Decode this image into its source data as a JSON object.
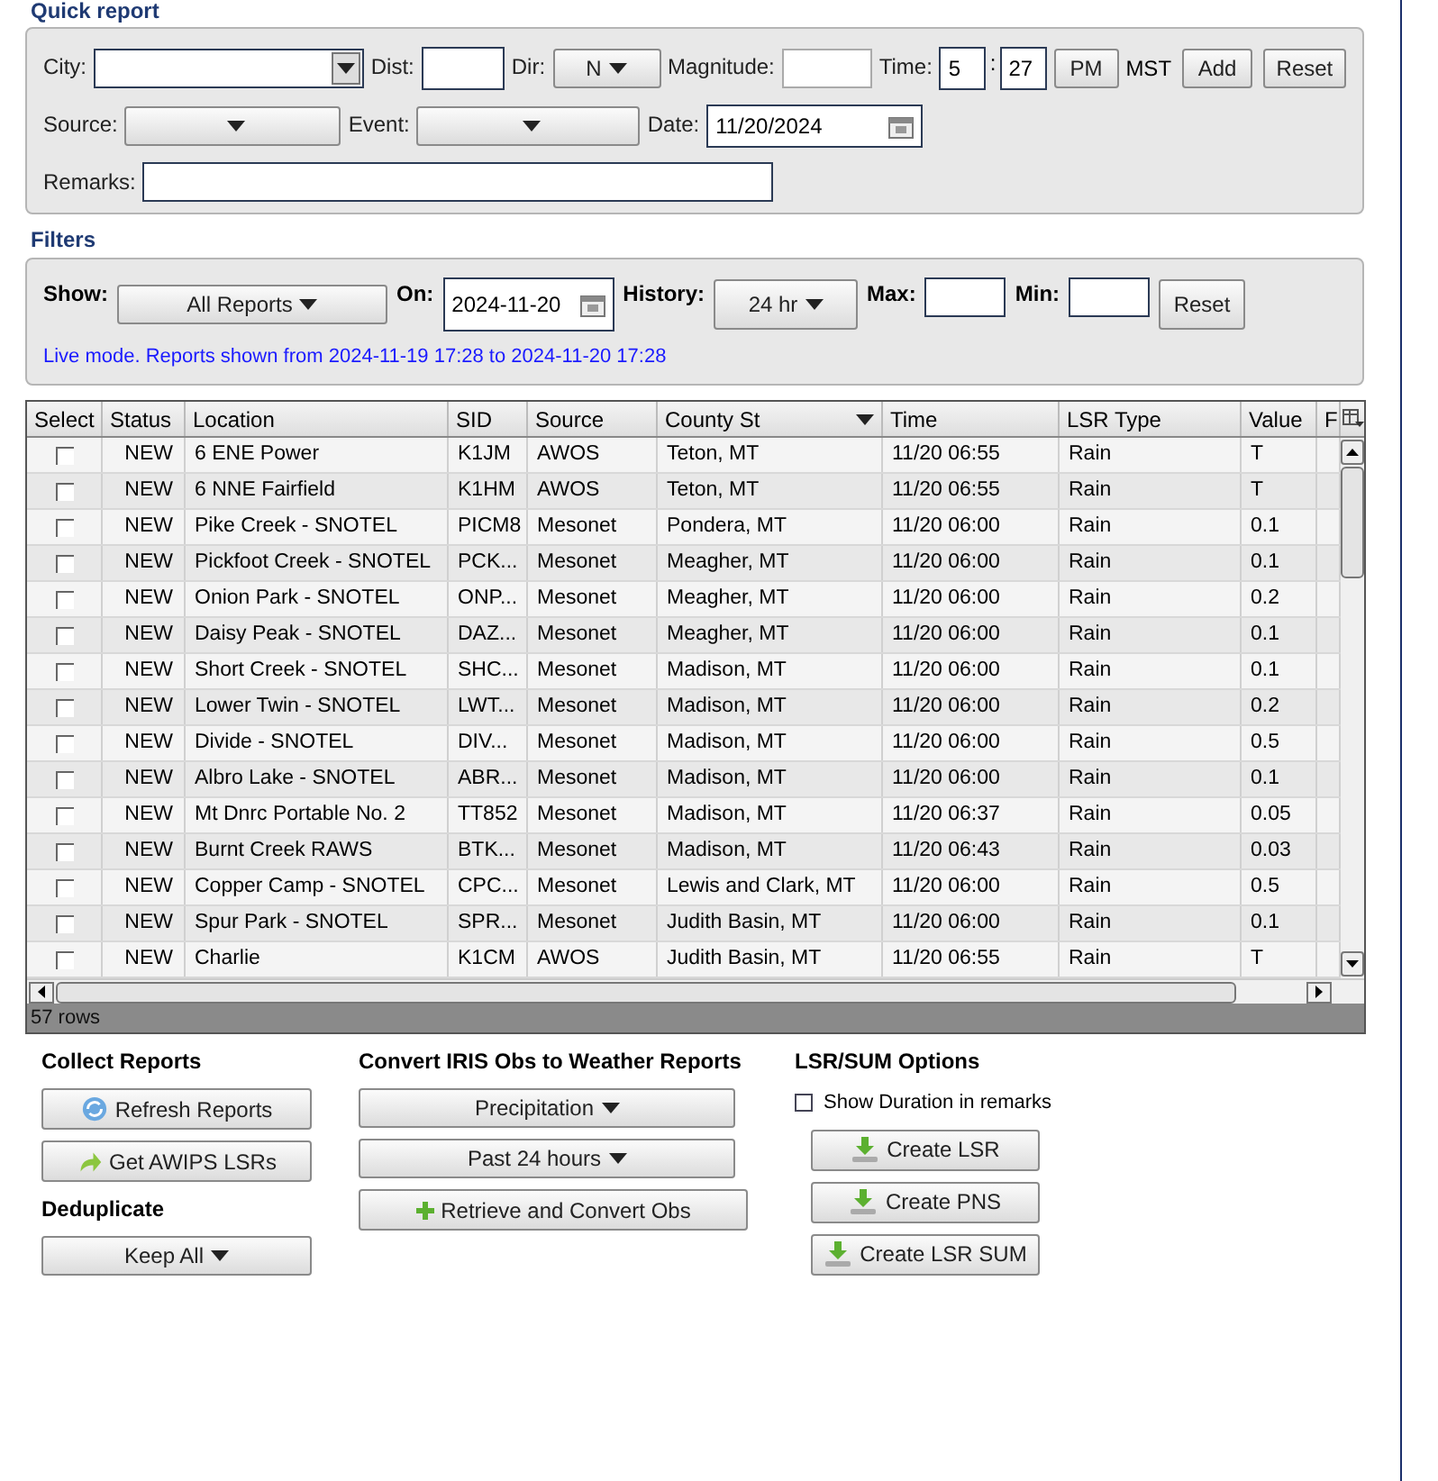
{
  "quick_report": {
    "title": "Quick report",
    "city_label": "City:",
    "dist_label": "Dist:",
    "dir_label": "Dir:",
    "dir_value": "N",
    "magnitude_label": "Magnitude:",
    "time_label": "Time:",
    "hour": "5",
    "time_sep": ":",
    "minute": "27",
    "ampm": "PM",
    "timezone": "MST",
    "add_button": "Add",
    "reset_button": "Reset",
    "source_label": "Source:",
    "event_label": "Event:",
    "date_label": "Date:",
    "date_value": "11/20/2024",
    "remarks_label": "Remarks:"
  },
  "filters": {
    "title": "Filters",
    "show_label": "Show:",
    "show_value": "All Reports",
    "on_label": "On:",
    "on_value": "2024-11-20",
    "history_label": "History:",
    "history_value": "24 hr",
    "max_label": "Max:",
    "min_label": "Min:",
    "reset_button": "Reset",
    "status_text": "Live mode. Reports shown from 2024-11-19 17:28 to 2024-11-20 17:28"
  },
  "table": {
    "columns": [
      "Select",
      "Status",
      "Location",
      "SID",
      "Source",
      "County St",
      "Time",
      "LSR Type",
      "Value",
      "F"
    ],
    "rows": [
      {
        "selected": false,
        "status": "NEW",
        "location": "6 ENE Power",
        "sid": "K1JM",
        "source": "AWOS",
        "county": "Teton, MT",
        "time": "11/20 06:55",
        "type": "Rain",
        "value": "T"
      },
      {
        "selected": false,
        "status": "NEW",
        "location": "6 NNE Fairfield",
        "sid": "K1HM",
        "source": "AWOS",
        "county": "Teton, MT",
        "time": "11/20 06:55",
        "type": "Rain",
        "value": "T"
      },
      {
        "selected": false,
        "status": "NEW",
        "location": "Pike Creek - SNOTEL",
        "sid": "PICM8",
        "source": "Mesonet",
        "county": "Pondera, MT",
        "time": "11/20 06:00",
        "type": "Rain",
        "value": "0.1"
      },
      {
        "selected": false,
        "status": "NEW",
        "location": "Pickfoot Creek - SNOTEL",
        "sid": "PCK...",
        "source": "Mesonet",
        "county": "Meagher, MT",
        "time": "11/20 06:00",
        "type": "Rain",
        "value": "0.1"
      },
      {
        "selected": false,
        "status": "NEW",
        "location": "Onion Park - SNOTEL",
        "sid": "ONP...",
        "source": "Mesonet",
        "county": "Meagher, MT",
        "time": "11/20 06:00",
        "type": "Rain",
        "value": "0.2"
      },
      {
        "selected": false,
        "status": "NEW",
        "location": "Daisy Peak - SNOTEL",
        "sid": "DAZ...",
        "source": "Mesonet",
        "county": "Meagher, MT",
        "time": "11/20 06:00",
        "type": "Rain",
        "value": "0.1"
      },
      {
        "selected": false,
        "status": "NEW",
        "location": "Short Creek - SNOTEL",
        "sid": "SHC...",
        "source": "Mesonet",
        "county": "Madison, MT",
        "time": "11/20 06:00",
        "type": "Rain",
        "value": "0.1"
      },
      {
        "selected": false,
        "status": "NEW",
        "location": "Lower Twin - SNOTEL",
        "sid": "LWT...",
        "source": "Mesonet",
        "county": "Madison, MT",
        "time": "11/20 06:00",
        "type": "Rain",
        "value": "0.2"
      },
      {
        "selected": false,
        "status": "NEW",
        "location": "Divide - SNOTEL",
        "sid": "DIV...",
        "source": "Mesonet",
        "county": "Madison, MT",
        "time": "11/20 06:00",
        "type": "Rain",
        "value": "0.5"
      },
      {
        "selected": false,
        "status": "NEW",
        "location": "Albro Lake - SNOTEL",
        "sid": "ABR...",
        "source": "Mesonet",
        "county": "Madison, MT",
        "time": "11/20 06:00",
        "type": "Rain",
        "value": "0.1"
      },
      {
        "selected": false,
        "status": "NEW",
        "location": "Mt Dnrc Portable No. 2",
        "sid": "TT852",
        "source": "Mesonet",
        "county": "Madison, MT",
        "time": "11/20 06:37",
        "type": "Rain",
        "value": "0.05"
      },
      {
        "selected": false,
        "status": "NEW",
        "location": "Burnt Creek RAWS",
        "sid": "BTK...",
        "source": "Mesonet",
        "county": "Madison, MT",
        "time": "11/20 06:43",
        "type": "Rain",
        "value": "0.03"
      },
      {
        "selected": false,
        "status": "NEW",
        "location": "Copper Camp - SNOTEL",
        "sid": "CPC...",
        "source": "Mesonet",
        "county": "Lewis and Clark, MT",
        "time": "11/20 06:00",
        "type": "Rain",
        "value": "0.5"
      },
      {
        "selected": false,
        "status": "NEW",
        "location": "Spur Park - SNOTEL",
        "sid": "SPR...",
        "source": "Mesonet",
        "county": "Judith Basin, MT",
        "time": "11/20 06:00",
        "type": "Rain",
        "value": "0.1"
      },
      {
        "selected": false,
        "status": "NEW",
        "location": "Charlie",
        "sid": "K1CM",
        "source": "AWOS",
        "county": "Judith Basin, MT",
        "time": "11/20 06:55",
        "type": "Rain",
        "value": "T"
      }
    ],
    "row_count": "57 rows"
  },
  "collect": {
    "title": "Collect Reports",
    "refresh_button": "Refresh Reports",
    "awips_button": "Get AWIPS LSRs",
    "dedup_title": "Deduplicate",
    "dedup_value": "Keep All"
  },
  "convert": {
    "title": "Convert IRIS Obs to Weather Reports",
    "obs_type": "Precipitation",
    "period": "Past 24 hours",
    "retrieve_button": "Retrieve and Convert Obs"
  },
  "lsr_options": {
    "title": "LSR/SUM Options",
    "show_duration": {
      "label": "Show Duration in remarks",
      "checked": false
    },
    "buttons": [
      "Create LSR",
      "Create PNS",
      "Create LSR SUM"
    ]
  }
}
